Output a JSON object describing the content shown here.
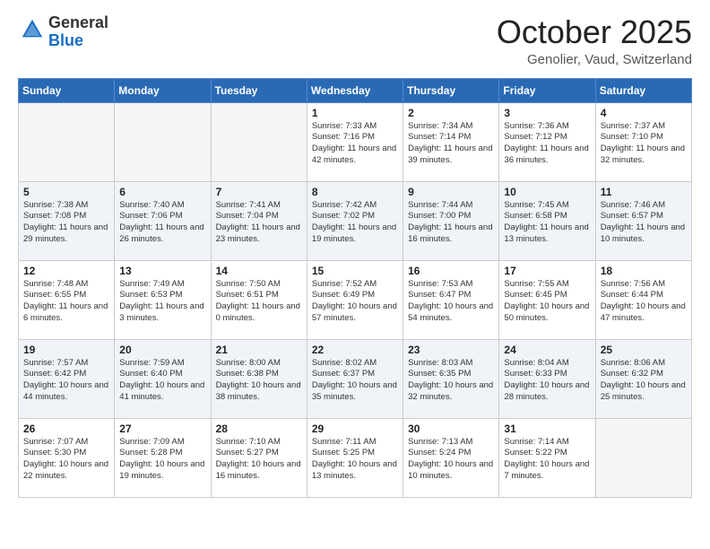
{
  "header": {
    "logo_general": "General",
    "logo_blue": "Blue",
    "month_title": "October 2025",
    "location": "Genolier, Vaud, Switzerland"
  },
  "days_of_week": [
    "Sunday",
    "Monday",
    "Tuesday",
    "Wednesday",
    "Thursday",
    "Friday",
    "Saturday"
  ],
  "weeks": [
    [
      {
        "day": "",
        "empty": true
      },
      {
        "day": "",
        "empty": true
      },
      {
        "day": "",
        "empty": true
      },
      {
        "day": "1",
        "sunrise": "7:33 AM",
        "sunset": "7:16 PM",
        "daylight": "11 hours and 42 minutes."
      },
      {
        "day": "2",
        "sunrise": "7:34 AM",
        "sunset": "7:14 PM",
        "daylight": "11 hours and 39 minutes."
      },
      {
        "day": "3",
        "sunrise": "7:36 AM",
        "sunset": "7:12 PM",
        "daylight": "11 hours and 36 minutes."
      },
      {
        "day": "4",
        "sunrise": "7:37 AM",
        "sunset": "7:10 PM",
        "daylight": "11 hours and 32 minutes."
      }
    ],
    [
      {
        "day": "5",
        "sunrise": "7:38 AM",
        "sunset": "7:08 PM",
        "daylight": "11 hours and 29 minutes."
      },
      {
        "day": "6",
        "sunrise": "7:40 AM",
        "sunset": "7:06 PM",
        "daylight": "11 hours and 26 minutes."
      },
      {
        "day": "7",
        "sunrise": "7:41 AM",
        "sunset": "7:04 PM",
        "daylight": "11 hours and 23 minutes."
      },
      {
        "day": "8",
        "sunrise": "7:42 AM",
        "sunset": "7:02 PM",
        "daylight": "11 hours and 19 minutes."
      },
      {
        "day": "9",
        "sunrise": "7:44 AM",
        "sunset": "7:00 PM",
        "daylight": "11 hours and 16 minutes."
      },
      {
        "day": "10",
        "sunrise": "7:45 AM",
        "sunset": "6:58 PM",
        "daylight": "11 hours and 13 minutes."
      },
      {
        "day": "11",
        "sunrise": "7:46 AM",
        "sunset": "6:57 PM",
        "daylight": "11 hours and 10 minutes."
      }
    ],
    [
      {
        "day": "12",
        "sunrise": "7:48 AM",
        "sunset": "6:55 PM",
        "daylight": "11 hours and 6 minutes."
      },
      {
        "day": "13",
        "sunrise": "7:49 AM",
        "sunset": "6:53 PM",
        "daylight": "11 hours and 3 minutes."
      },
      {
        "day": "14",
        "sunrise": "7:50 AM",
        "sunset": "6:51 PM",
        "daylight": "11 hours and 0 minutes."
      },
      {
        "day": "15",
        "sunrise": "7:52 AM",
        "sunset": "6:49 PM",
        "daylight": "10 hours and 57 minutes."
      },
      {
        "day": "16",
        "sunrise": "7:53 AM",
        "sunset": "6:47 PM",
        "daylight": "10 hours and 54 minutes."
      },
      {
        "day": "17",
        "sunrise": "7:55 AM",
        "sunset": "6:45 PM",
        "daylight": "10 hours and 50 minutes."
      },
      {
        "day": "18",
        "sunrise": "7:56 AM",
        "sunset": "6:44 PM",
        "daylight": "10 hours and 47 minutes."
      }
    ],
    [
      {
        "day": "19",
        "sunrise": "7:57 AM",
        "sunset": "6:42 PM",
        "daylight": "10 hours and 44 minutes."
      },
      {
        "day": "20",
        "sunrise": "7:59 AM",
        "sunset": "6:40 PM",
        "daylight": "10 hours and 41 minutes."
      },
      {
        "day": "21",
        "sunrise": "8:00 AM",
        "sunset": "6:38 PM",
        "daylight": "10 hours and 38 minutes."
      },
      {
        "day": "22",
        "sunrise": "8:02 AM",
        "sunset": "6:37 PM",
        "daylight": "10 hours and 35 minutes."
      },
      {
        "day": "23",
        "sunrise": "8:03 AM",
        "sunset": "6:35 PM",
        "daylight": "10 hours and 32 minutes."
      },
      {
        "day": "24",
        "sunrise": "8:04 AM",
        "sunset": "6:33 PM",
        "daylight": "10 hours and 28 minutes."
      },
      {
        "day": "25",
        "sunrise": "8:06 AM",
        "sunset": "6:32 PM",
        "daylight": "10 hours and 25 minutes."
      }
    ],
    [
      {
        "day": "26",
        "sunrise": "7:07 AM",
        "sunset": "5:30 PM",
        "daylight": "10 hours and 22 minutes."
      },
      {
        "day": "27",
        "sunrise": "7:09 AM",
        "sunset": "5:28 PM",
        "daylight": "10 hours and 19 minutes."
      },
      {
        "day": "28",
        "sunrise": "7:10 AM",
        "sunset": "5:27 PM",
        "daylight": "10 hours and 16 minutes."
      },
      {
        "day": "29",
        "sunrise": "7:11 AM",
        "sunset": "5:25 PM",
        "daylight": "10 hours and 13 minutes."
      },
      {
        "day": "30",
        "sunrise": "7:13 AM",
        "sunset": "5:24 PM",
        "daylight": "10 hours and 10 minutes."
      },
      {
        "day": "31",
        "sunrise": "7:14 AM",
        "sunset": "5:22 PM",
        "daylight": "10 hours and 7 minutes."
      },
      {
        "day": "",
        "empty": true
      }
    ]
  ]
}
